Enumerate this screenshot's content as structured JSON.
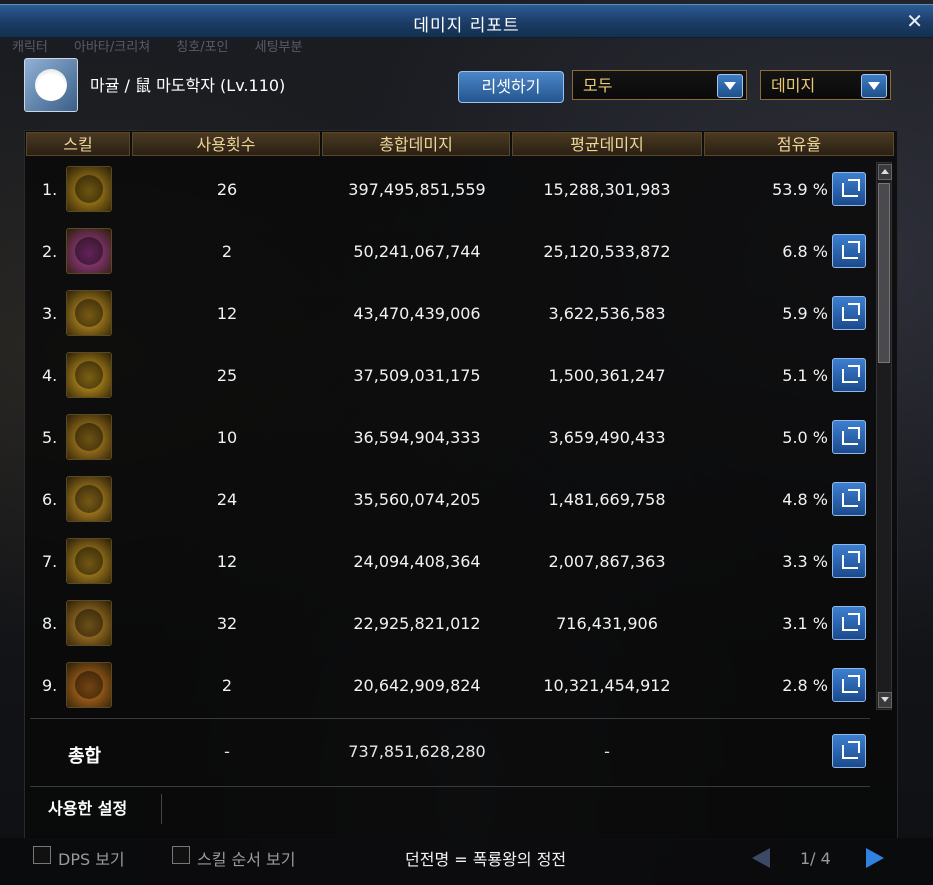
{
  "window": {
    "title": "데미지 리포트"
  },
  "background_tabs": "캐릭터 아바타/크리쳐 칭호/포인 세팅부분",
  "header": {
    "character": "마귤 / 鼠 마도학자 (Lv.110)",
    "reset_label": "리셋하기",
    "filter_select": "모두",
    "metric_select": "데미지"
  },
  "columns": {
    "skill": "스킬",
    "count": "사용횟수",
    "total": "총합데미지",
    "avg": "평균데미지",
    "share": "점유율"
  },
  "rows": [
    {
      "rank": "1.",
      "count": "26",
      "total": "397,495,851,559",
      "avg": "15,288,301,983",
      "share": "53.9 %",
      "icon_color": "#c69a1e"
    },
    {
      "rank": "2.",
      "count": "2",
      "total": "50,241,067,744",
      "avg": "25,120,533,872",
      "share": "6.8 %",
      "icon_color": "#b13fa8"
    },
    {
      "rank": "3.",
      "count": "12",
      "total": "43,470,439,006",
      "avg": "3,622,536,583",
      "share": "5.9 %",
      "icon_color": "#d8a526"
    },
    {
      "rank": "4.",
      "count": "25",
      "total": "37,509,031,175",
      "avg": "1,500,361,247",
      "share": "5.1 %",
      "icon_color": "#e0ad22"
    },
    {
      "rank": "5.",
      "count": "10",
      "total": "36,594,904,333",
      "avg": "3,659,490,433",
      "share": "5.0 %",
      "icon_color": "#c99624"
    },
    {
      "rank": "6.",
      "count": "24",
      "total": "35,560,074,205",
      "avg": "1,481,669,758",
      "share": "4.8 %",
      "icon_color": "#d6a228"
    },
    {
      "rank": "7.",
      "count": "12",
      "total": "24,094,408,364",
      "avg": "2,007,867,363",
      "share": "3.3 %",
      "icon_color": "#cf9f25"
    },
    {
      "rank": "8.",
      "count": "32",
      "total": "22,925,821,012",
      "avg": "716,431,906",
      "share": "3.1 %",
      "icon_color": "#c48f2a"
    },
    {
      "rank": "9.",
      "count": "2",
      "total": "20,642,909,824",
      "avg": "10,321,454,912",
      "share": "2.8 %",
      "icon_color": "#d27b22"
    }
  ],
  "totals": {
    "label": "총합",
    "count": "-",
    "total": "737,851,628,280",
    "avg": "-"
  },
  "settings_tab": "사용한 설정",
  "footer": {
    "dps_label": "DPS 보기",
    "skill_order_label": "스킬 순서 보기",
    "dungeon": "던전명 = 폭룡왕의 정전",
    "page": "1/ 4"
  }
}
